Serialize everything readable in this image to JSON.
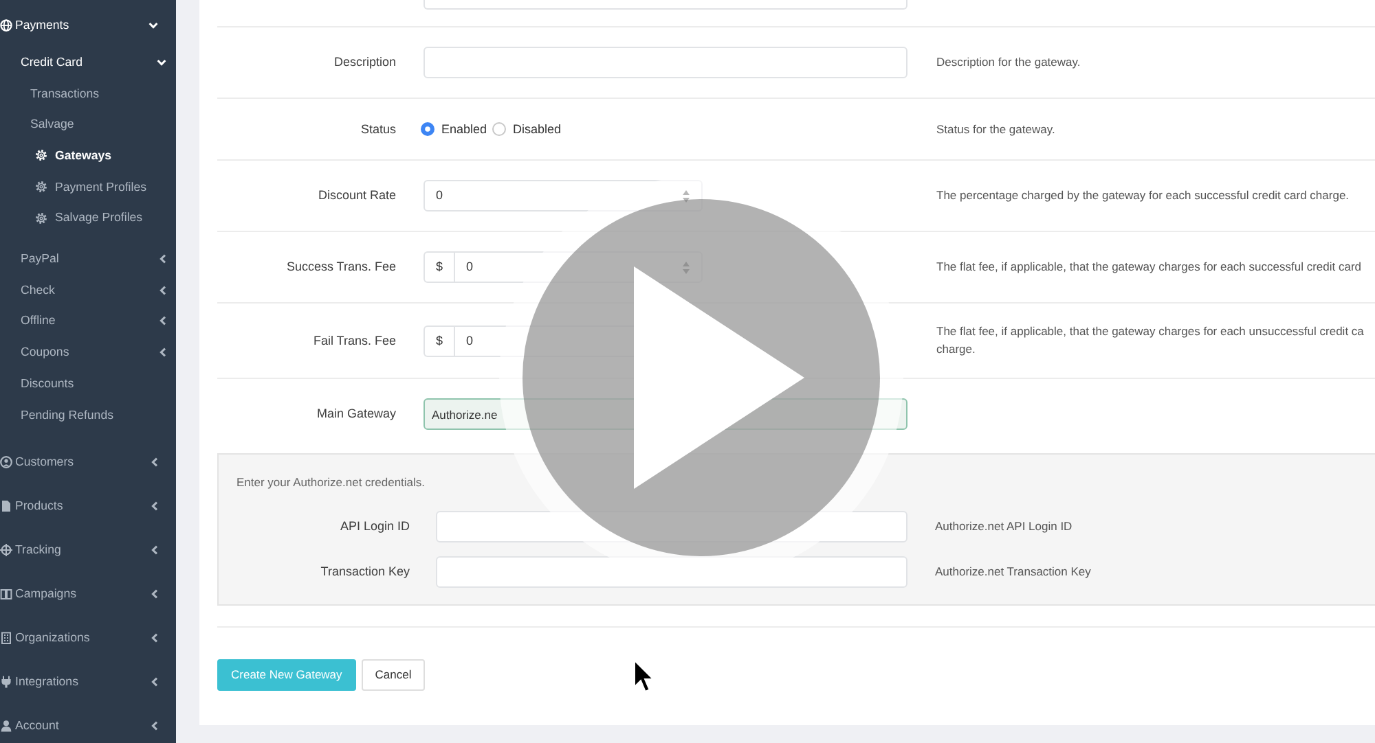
{
  "sidebar": {
    "items": [
      {
        "label": "Payments",
        "kind": "group",
        "expanded": true,
        "selected": false,
        "children": [
          {
            "label": "Credit Card",
            "kind": "group",
            "expanded": true,
            "selected": false,
            "children": [
              {
                "label": "Transactions",
                "kind": "link",
                "selected": false
              },
              {
                "label": "Salvage",
                "kind": "link",
                "selected": false
              },
              {
                "label": "Gateways",
                "kind": "setting",
                "selected": true
              },
              {
                "label": "Payment Profiles",
                "kind": "setting",
                "selected": false
              },
              {
                "label": "Salvage Profiles",
                "kind": "setting",
                "selected": false
              }
            ]
          },
          {
            "label": "PayPal",
            "kind": "group",
            "expanded": false,
            "selected": false
          },
          {
            "label": "Check",
            "kind": "group",
            "expanded": false,
            "selected": false
          },
          {
            "label": "Offline",
            "kind": "group",
            "expanded": false,
            "selected": false
          },
          {
            "label": "Coupons",
            "kind": "group",
            "expanded": false,
            "selected": false
          },
          {
            "label": "Discounts",
            "kind": "link",
            "selected": false
          },
          {
            "label": "Pending Refunds",
            "kind": "link",
            "selected": false
          }
        ]
      },
      {
        "label": "Customers",
        "kind": "group",
        "expanded": false,
        "selected": false
      },
      {
        "label": "Products",
        "kind": "group",
        "expanded": false,
        "selected": false
      },
      {
        "label": "Tracking",
        "kind": "group",
        "expanded": false,
        "selected": false
      },
      {
        "label": "Campaigns",
        "kind": "group",
        "expanded": false,
        "selected": false
      },
      {
        "label": "Organizations",
        "kind": "group",
        "expanded": false,
        "selected": false
      },
      {
        "label": "Integrations",
        "kind": "group",
        "expanded": false,
        "selected": false
      },
      {
        "label": "Account",
        "kind": "group",
        "expanded": false,
        "selected": false
      }
    ]
  },
  "form": {
    "rows": [
      {
        "label": "Description",
        "kind": "text",
        "help": "Description for the gateway."
      },
      {
        "label": "Status",
        "kind": "radio",
        "options": [
          {
            "label": "Enabled",
            "selected": true
          },
          {
            "label": "Disabled",
            "selected": false
          }
        ],
        "help": "Status for the gateway."
      },
      {
        "label": "Discount Rate",
        "kind": "number",
        "value": "0",
        "stepper": true,
        "help": "The percentage charged by the gateway for each successful credit card charge."
      },
      {
        "label": "Success Trans. Fee",
        "kind": "money",
        "prefix": "$",
        "value": "0",
        "stepper": true,
        "help": "The flat fee, if applicable, that the gateway charges for each successful credit card"
      },
      {
        "label": "Fail Trans. Fee",
        "kind": "money",
        "prefix": "$",
        "value": "0",
        "stepper": false,
        "help": "The flat fee, if applicable, that the gateway charges for each unsuccessful credit ca\ncharge."
      },
      {
        "label": "Main Gateway",
        "kind": "select",
        "value": "Authorize.ne"
      }
    ]
  },
  "credentials": {
    "intro": "Enter your Authorize.net credentials.",
    "fields": [
      {
        "label": "API Login ID",
        "help": "Authorize.net API Login ID"
      },
      {
        "label": "Transaction Key",
        "help": "Authorize.net Transaction Key"
      }
    ]
  },
  "actions": [
    {
      "label": "Create New Gateway",
      "kind": "primary"
    },
    {
      "label": "Cancel",
      "kind": "secondary"
    }
  ]
}
